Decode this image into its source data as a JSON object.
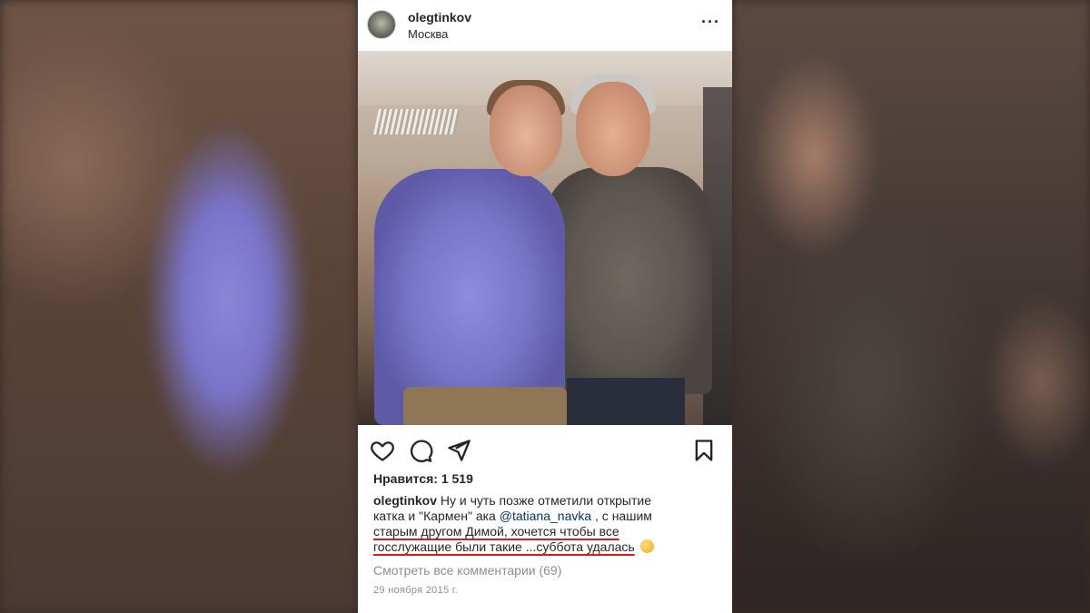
{
  "post": {
    "username": "olegtinkov",
    "location": "Москва",
    "more_label": "···",
    "likes_label": "Нравится: 1 519",
    "caption": {
      "username": "olegtinkov",
      "line1_text": " Ну и чуть позже отметили открытие",
      "line2_text_a": "катка и \"Кармен\" ака ",
      "line2_mention": "@tatiana_navka",
      "line2_text_b": " , с нашим",
      "line3_underlined": "старым другом Димой, хочется чтобы все",
      "line4_underlined": "госслужащие были такие ...суббота удалась",
      "emoji": "smiling-face-emoji"
    },
    "view_comments": "Смотреть все комментарии (69)",
    "date": "29 ноября 2015 г."
  },
  "icons": [
    "heart-icon",
    "comment-icon",
    "share-icon",
    "bookmark-icon",
    "more-options-icon"
  ],
  "colors": {
    "text": "#262626",
    "muted": "#8e8e8e",
    "mention": "#00376b",
    "annotation_underline": "#e01818"
  }
}
